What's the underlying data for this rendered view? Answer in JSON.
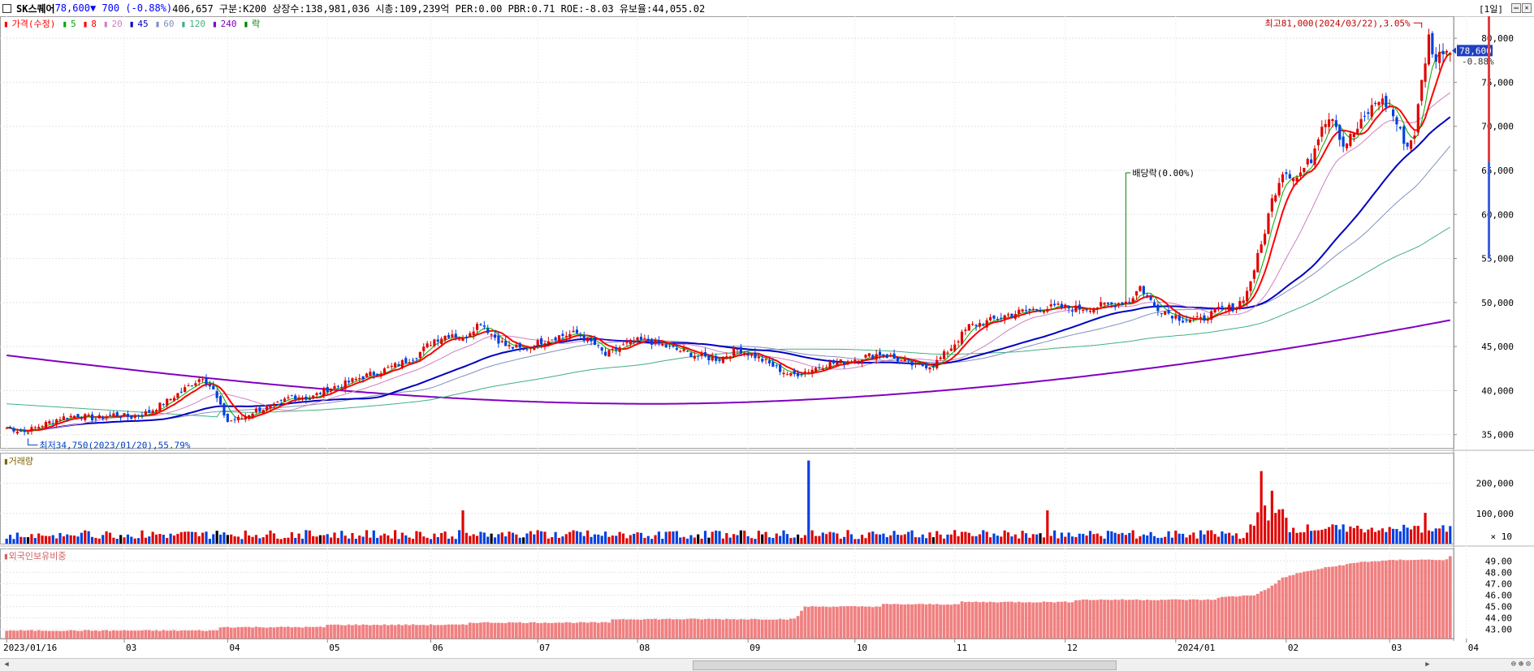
{
  "header": {
    "symbol": "SK스퀘어",
    "price": "78,600",
    "change_arrow": "▼",
    "change": "700",
    "change_pct": "(-0.88%)",
    "info": "406,657  구분:K200 상장수:138,981,036 시총:109,239억 PER:0.00 PBR:0.71 ROE:-8.03 유보율:44,055.02",
    "period": "[1일]"
  },
  "legend": [
    {
      "label": "가격(수정)",
      "color": "#ff0000"
    },
    {
      "label": "5",
      "color": "#00aa00"
    },
    {
      "label": "8",
      "color": "#ff0000"
    },
    {
      "label": "20",
      "color": "#d080c0"
    },
    {
      "label": "45",
      "color": "#0000c0"
    },
    {
      "label": "60",
      "color": "#8090c0"
    },
    {
      "label": "120",
      "color": "#40b080"
    },
    {
      "label": "240",
      "color": "#8000c0"
    },
    {
      "label": "락",
      "color": "#008000"
    }
  ],
  "volume_label": "거래량",
  "foreign_label": "외국인보유비중",
  "chart_data": [
    {
      "type": "candlestick",
      "y_ticks": [
        "80,000",
        "75,000",
        "70,000",
        "65,000",
        "60,000",
        "55,000",
        "50,000",
        "45,000",
        "40,000",
        "35,000"
      ],
      "ylim": [
        33500,
        82500
      ],
      "current_price_label": "78,600",
      "current_change_label": "-0.88%",
      "annotations": {
        "high": "최고81,000(2024/03/22),3.05%",
        "low": "최저34,750(2023/01/20),55.79%",
        "dividend": "배당락(0.00%)"
      },
      "x_ticks": [
        "2023/01/16",
        "03",
        "04",
        "05",
        "06",
        "07",
        "08",
        "09",
        "10",
        "11",
        "12",
        "2024/01",
        "02",
        "03",
        "04"
      ],
      "price_path": [
        [
          0,
          35800
        ],
        [
          5,
          35300
        ],
        [
          10,
          36100
        ],
        [
          15,
          36900
        ],
        [
          20,
          37200
        ],
        [
          25,
          36800
        ],
        [
          30,
          37300
        ],
        [
          35,
          37000
        ],
        [
          40,
          37600
        ],
        [
          45,
          38800
        ],
        [
          50,
          40200
        ],
        [
          55,
          41600
        ],
        [
          58,
          40000
        ],
        [
          60,
          38100
        ],
        [
          62,
          36500
        ],
        [
          66,
          36900
        ],
        [
          70,
          37800
        ],
        [
          75,
          38200
        ],
        [
          80,
          39400
        ],
        [
          85,
          39100
        ],
        [
          90,
          40200
        ],
        [
          95,
          40800
        ],
        [
          100,
          41600
        ],
        [
          105,
          42200
        ],
        [
          110,
          43000
        ],
        [
          115,
          44000
        ],
        [
          120,
          45800
        ],
        [
          125,
          46500
        ],
        [
          128,
          45700
        ],
        [
          130,
          46800
        ],
        [
          133,
          47800
        ],
        [
          136,
          46400
        ],
        [
          140,
          45100
        ],
        [
          145,
          44600
        ],
        [
          150,
          45600
        ],
        [
          155,
          46200
        ],
        [
          160,
          46500
        ],
        [
          165,
          45200
        ],
        [
          168,
          44000
        ],
        [
          172,
          44900
        ],
        [
          176,
          45600
        ],
        [
          180,
          45700
        ],
        [
          185,
          45000
        ],
        [
          190,
          44400
        ],
        [
          195,
          43800
        ],
        [
          200,
          43600
        ],
        [
          205,
          44700
        ],
        [
          210,
          43900
        ],
        [
          215,
          42800
        ],
        [
          220,
          41700
        ],
        [
          225,
          42300
        ],
        [
          230,
          43000
        ],
        [
          235,
          43300
        ],
        [
          240,
          43800
        ],
        [
          245,
          44200
        ],
        [
          250,
          43500
        ],
        [
          255,
          42800
        ],
        [
          260,
          42900
        ],
        [
          265,
          44900
        ],
        [
          270,
          47300
        ],
        [
          275,
          47800
        ],
        [
          280,
          48500
        ],
        [
          285,
          49000
        ],
        [
          290,
          49300
        ],
        [
          295,
          49500
        ],
        [
          300,
          49300
        ],
        [
          305,
          49500
        ],
        [
          310,
          49800
        ],
        [
          315,
          50200
        ],
        [
          318,
          51800
        ],
        [
          322,
          49600
        ],
        [
          326,
          48800
        ],
        [
          330,
          48100
        ],
        [
          335,
          48000
        ],
        [
          340,
          49200
        ],
        [
          345,
          49500
        ],
        [
          348,
          51200
        ],
        [
          352,
          56500
        ],
        [
          355,
          61600
        ],
        [
          358,
          65000
        ],
        [
          362,
          64200
        ],
        [
          366,
          66300
        ],
        [
          369,
          70400
        ],
        [
          372,
          71300
        ],
        [
          375,
          67800
        ],
        [
          379,
          69700
        ],
        [
          382,
          71600
        ],
        [
          385,
          73100
        ],
        [
          388,
          72200
        ],
        [
          391,
          69300
        ],
        [
          393,
          67700
        ],
        [
          395,
          69300
        ],
        [
          397,
          75000
        ],
        [
          399,
          80100
        ],
        [
          401,
          77400
        ],
        [
          403,
          78800
        ],
        [
          405,
          78600
        ]
      ],
      "series_end_values": {
        "ma5": 78000,
        "ma8": 76000,
        "ma20": 73000,
        "ma45": 66500,
        "ma60": 62000,
        "ma120": 54500,
        "ma240": 49000
      }
    },
    {
      "type": "bar",
      "name": "거래량",
      "y_ticks": [
        "200,000",
        "100,000"
      ],
      "unit_label": "× 10",
      "ylim": [
        0,
        290000
      ],
      "spikes": [
        [
          225,
          275000
        ],
        [
          352,
          240000
        ],
        [
          355,
          175000
        ],
        [
          292,
          110000
        ],
        [
          128,
          110000
        ],
        [
          398,
          102000
        ]
      ]
    },
    {
      "type": "bar",
      "name": "외국인보유비중",
      "y_ticks": [
        "49.00",
        "48.00",
        "47.00",
        "46.00",
        "45.00",
        "44.00",
        "43.00"
      ],
      "ylim": [
        42.2,
        49.8
      ],
      "steps": [
        [
          0,
          42.9
        ],
        [
          60,
          43.2
        ],
        [
          90,
          43.4
        ],
        [
          130,
          43.6
        ],
        [
          170,
          43.9
        ],
        [
          222,
          44.2
        ],
        [
          224,
          45.0
        ],
        [
          246,
          45.2
        ],
        [
          268,
          45.4
        ],
        [
          300,
          45.6
        ],
        [
          340,
          45.8
        ],
        [
          350,
          46.0
        ],
        [
          354,
          46.6
        ],
        [
          358,
          47.5
        ],
        [
          362,
          47.9
        ],
        [
          370,
          48.4
        ],
        [
          380,
          48.9
        ],
        [
          392,
          49.1
        ],
        [
          405,
          49.4
        ]
      ]
    }
  ],
  "scroll": {
    "left_arrow": "◀",
    "right_arrow": "▶"
  },
  "zoom_icons": [
    "minus-zoom",
    "plus-zoom",
    "reset-zoom"
  ]
}
